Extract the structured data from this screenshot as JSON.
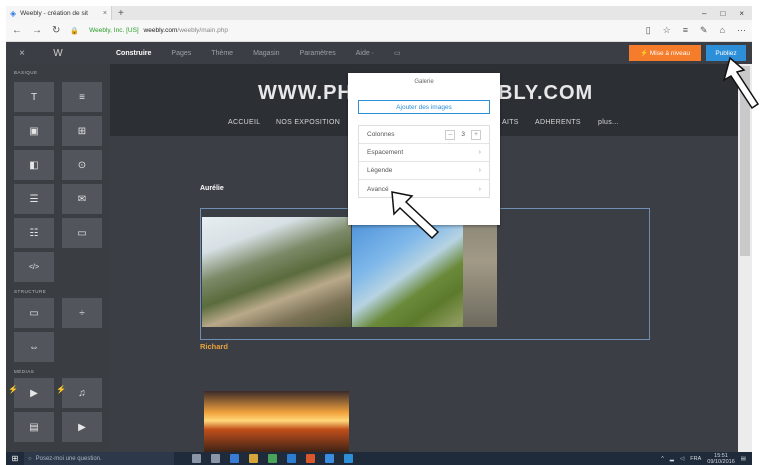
{
  "browser": {
    "tab_title": "Weebly - création de sit",
    "tab_close": "×",
    "new_tab": "+",
    "window_controls": [
      "–",
      "□",
      "×"
    ],
    "nav_back": "←",
    "nav_forward": "→",
    "nav_refresh": "↻",
    "url_secure_label": "Weebly, Inc. [US]",
    "url_host": "weebly.com",
    "url_path": "/weebly/main.php"
  },
  "weebly_topbar": {
    "close": "×",
    "logo": "W",
    "nav": [
      "Construire",
      "Pages",
      "Thème",
      "Magasin",
      "Paramètres",
      "Aide ·"
    ],
    "upgrade_label": "⚡ Mise à niveau",
    "publish_label": "Publiez"
  },
  "sidebar": {
    "sections": {
      "basic": "BASIQUE",
      "structure": "STRUCTURE",
      "media": "MÉDIAS"
    },
    "tools_basic": [
      {
        "icon": "title-icon",
        "glyph": "T"
      },
      {
        "icon": "text-icon",
        "glyph": "≡"
      },
      {
        "icon": "image-icon",
        "glyph": "▣"
      },
      {
        "icon": "gallery-icon",
        "glyph": "⊞"
      },
      {
        "icon": "slideshow-icon",
        "glyph": "◧"
      },
      {
        "icon": "map-icon",
        "glyph": "⊙"
      },
      {
        "icon": "form-icon",
        "glyph": "☰"
      },
      {
        "icon": "email-icon",
        "glyph": "✉"
      },
      {
        "icon": "survey-icon",
        "glyph": "☷"
      },
      {
        "icon": "button-icon",
        "glyph": "▭"
      },
      {
        "icon": "embed-code-icon",
        "glyph": "</>"
      }
    ],
    "tools_structure": [
      {
        "icon": "section-icon",
        "glyph": "▭"
      },
      {
        "icon": "divider-icon",
        "glyph": "÷"
      },
      {
        "icon": "spacer-icon",
        "glyph": "⇔"
      }
    ],
    "tools_media": [
      {
        "icon": "hd-video-icon",
        "glyph": "▶"
      },
      {
        "icon": "audio-icon",
        "glyph": "♫"
      },
      {
        "icon": "document-icon",
        "glyph": "▤"
      },
      {
        "icon": "youtube-icon",
        "glyph": "▶"
      }
    ]
  },
  "site": {
    "title_left": "WWW.PH",
    "title_right": "BLY.COM",
    "nav_left": [
      "ACCUEIL",
      "NOS EXPOSITION"
    ],
    "nav_right": [
      "AITS",
      "ADHERENTS",
      "plus..."
    ],
    "caption1": "Aurélie",
    "caption2": "Richard"
  },
  "gallery_popup": {
    "title": "Galerie",
    "add_button": "Ajouter des images",
    "rows": [
      {
        "label": "Colonnes",
        "stepper": {
          "minus": "–",
          "value": "3",
          "plus": "+"
        }
      },
      {
        "label": "Espacement",
        "chevron": "›"
      },
      {
        "label": "Légende",
        "chevron": "›"
      },
      {
        "label": "Avancé",
        "chevron": "›"
      }
    ]
  },
  "taskbar": {
    "start": "⊞",
    "search_placeholder": "Posez-moi une question.",
    "tray_lang": "FRA",
    "time": "15:51",
    "date": "09/10/2016"
  }
}
